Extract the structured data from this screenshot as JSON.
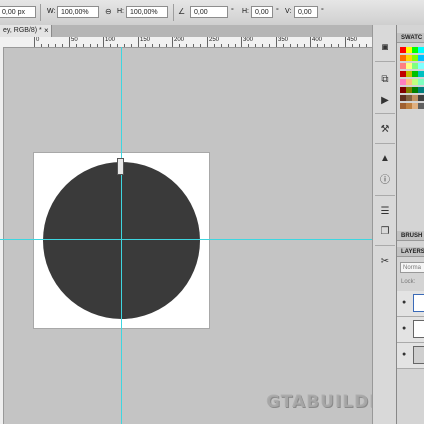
{
  "options_bar": {
    "x_value": "0,00 px",
    "w_label": "W:",
    "w_value": "100,00%",
    "h_label": "H:",
    "h_value": "100,00%",
    "angle_value": "0,00",
    "hskew_label": "H:",
    "hskew_value": "0,00",
    "vskew_label": "V:",
    "vskew_value": "0,00",
    "degree_symbol": "°"
  },
  "document_tab": {
    "title": "ey, RGB/8) *",
    "close_glyph": "×"
  },
  "ruler": {
    "labels": [
      "0",
      "50",
      "100",
      "150",
      "200",
      "250",
      "300",
      "350",
      "400",
      "450"
    ]
  },
  "panels": {
    "swatches_title": "SWATC",
    "brushes_title": "BRUSH",
    "layers_title": "LAYERS",
    "blend_mode": "Norma",
    "lock_label": "Lock:"
  },
  "watermark": "GTABUILDER.RU",
  "colors": {
    "guide": "#3ed6e0",
    "shape": "#3a3a3a",
    "canvas_bg": "#c4c4c4"
  }
}
